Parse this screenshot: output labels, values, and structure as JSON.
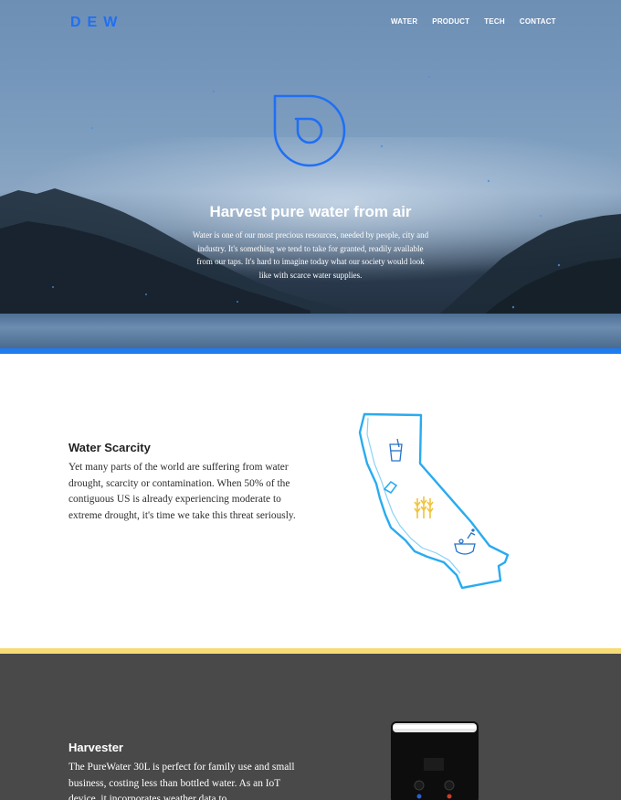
{
  "brand": {
    "name": "DEW",
    "color": "#1f6ff5"
  },
  "nav": {
    "items": [
      "WATER",
      "PRODUCT",
      "TECH",
      "CONTACT"
    ]
  },
  "hero": {
    "logo_icon": "dew-drop-logo-icon",
    "title": "Harvest pure water from air",
    "text": "Water is one of our most precious resources, needed by people, city and industry. It's something we tend to take for granted, readily available from our taps. It's hard to imagine today what our society would look like with scarce water supplies.",
    "accent_color": "#1e7bf0"
  },
  "scarcity": {
    "title": "Water Scarcity",
    "text": "Yet many parts of the world are suffering from water drought, scarcity or contamination. When 50% of the contiguous US is already experiencing moderate to extreme drought, it's time we take this threat seriously.",
    "map_icon": "california-map-icon",
    "map_color": "#29abf0",
    "divider_color": "#f7dc76"
  },
  "harvester": {
    "title": "Harvester",
    "text": "The PureWater 30L is perfect for family use and small business, costing less than bottled water. As an IoT device, it incorporates weather data to",
    "device_icon": "water-harvester-device-icon",
    "background": "#494949"
  }
}
